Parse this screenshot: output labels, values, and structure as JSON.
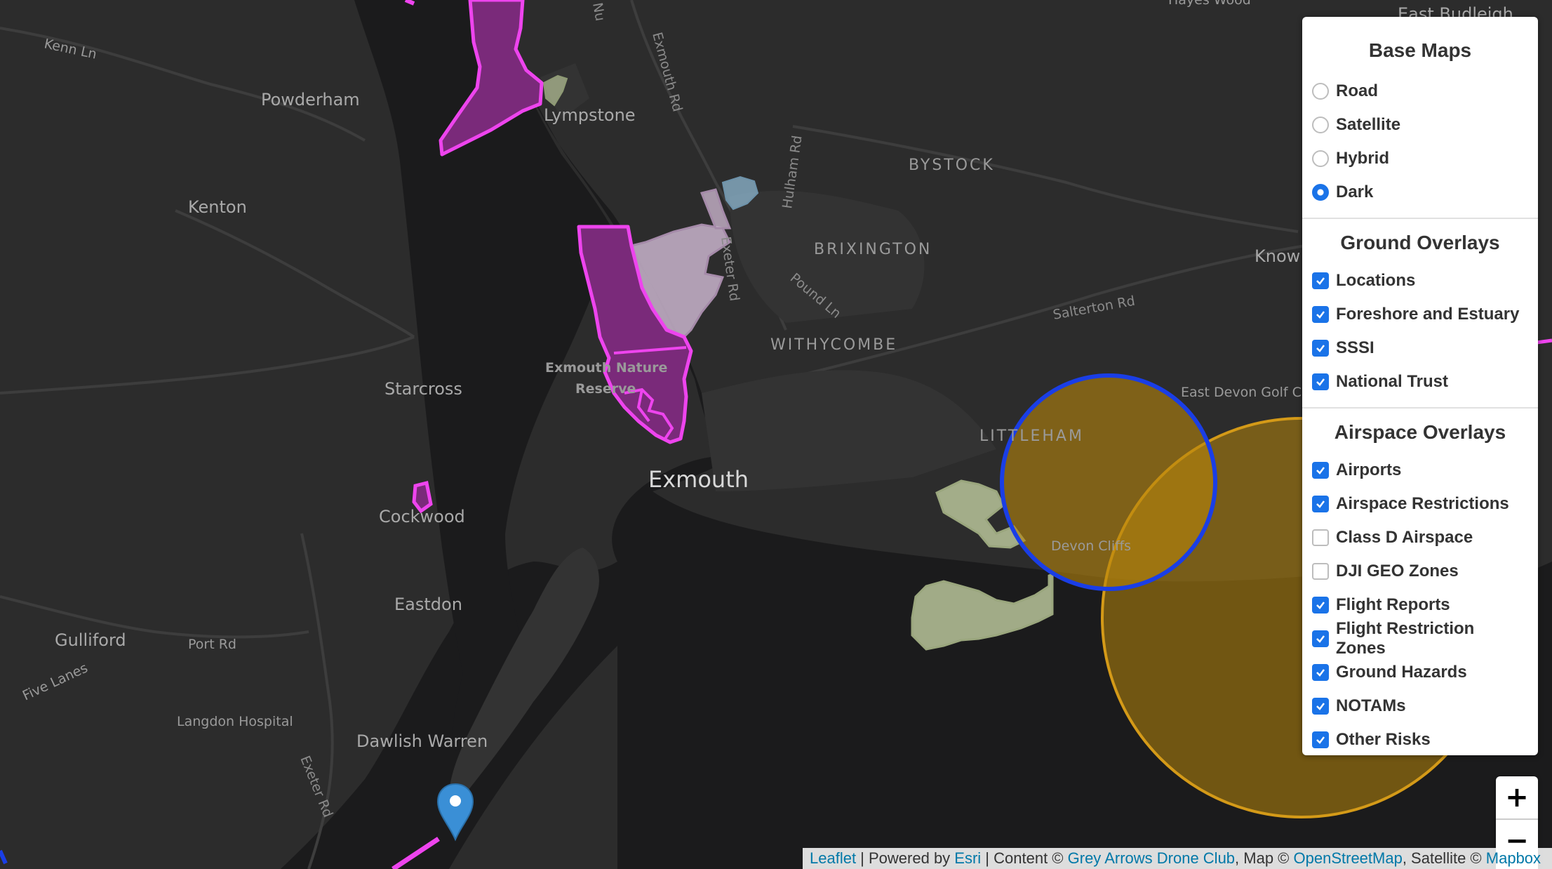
{
  "map": {
    "places": [
      {
        "id": "kenn-ln",
        "text": "Kenn Ln"
      },
      {
        "id": "powderham",
        "text": "Powderham"
      },
      {
        "id": "lympstone",
        "text": "Lympstone"
      },
      {
        "id": "exmouth-rd",
        "text": "Exmouth Rd"
      },
      {
        "id": "hulham-rd",
        "text": "Hulham Rd"
      },
      {
        "id": "bystock",
        "text": "BYSTOCK"
      },
      {
        "id": "kenton",
        "text": "Kenton"
      },
      {
        "id": "brixington",
        "text": "BRIXINGTON"
      },
      {
        "id": "exeter-rd-north",
        "text": "Exeter Rd"
      },
      {
        "id": "pound-ln",
        "text": "Pound Ln"
      },
      {
        "id": "salterton-rd",
        "text": "Salterton Rd"
      },
      {
        "id": "withycombe",
        "text": "WITHYCOMBE"
      },
      {
        "id": "exmouth-nature-reserve-1",
        "text": "Exmouth Nature"
      },
      {
        "id": "exmouth-nature-reserve-2",
        "text": "Reserve"
      },
      {
        "id": "starcross",
        "text": "Starcross"
      },
      {
        "id": "east-devon-golf",
        "text": "East Devon Golf C"
      },
      {
        "id": "littleham",
        "text": "LITTLEHAM"
      },
      {
        "id": "exmouth",
        "text": "Exmouth"
      },
      {
        "id": "cockwood",
        "text": "Cockwood"
      },
      {
        "id": "devon-cliffs",
        "text": "Devon Cliffs"
      },
      {
        "id": "eastdon",
        "text": "Eastdon"
      },
      {
        "id": "gulliford",
        "text": "Gulliford"
      },
      {
        "id": "port-rd",
        "text": "Port Rd"
      },
      {
        "id": "five-lanes",
        "text": "Five Lanes"
      },
      {
        "id": "langdon-hospital",
        "text": "Langdon Hospital"
      },
      {
        "id": "dawlish-warren",
        "text": "Dawlish Warren"
      },
      {
        "id": "exeter-rd-south",
        "text": "Exeter Rd"
      },
      {
        "id": "hayes-wood",
        "text": "Hayes Wood"
      },
      {
        "id": "east-budleigh",
        "text": "East Budleigh"
      },
      {
        "id": "knowle",
        "text": "Know"
      },
      {
        "id": "nu",
        "text": "Nu"
      }
    ],
    "colors": {
      "land": "#2c2c2c",
      "water": "#1b1b1c",
      "sssi_fill": "#7a2a7a",
      "sssi_stroke": "#ee44ee",
      "airport_stroke": "#1a3ee6",
      "restriction_fill": "#b8860b",
      "trust_fill": "#b9c49a",
      "marker": "#3a8fd6"
    }
  },
  "layers": {
    "base_title": "Base Maps",
    "base": [
      {
        "label": "Road",
        "selected": false
      },
      {
        "label": "Satellite",
        "selected": false
      },
      {
        "label": "Hybrid",
        "selected": false
      },
      {
        "label": "Dark",
        "selected": true
      }
    ],
    "ground_title": "Ground Overlays",
    "ground": [
      {
        "label": "Locations",
        "checked": true
      },
      {
        "label": "Foreshore and Estuary",
        "checked": true
      },
      {
        "label": "SSSI",
        "checked": true
      },
      {
        "label": "National Trust",
        "checked": true
      }
    ],
    "air_title": "Airspace Overlays",
    "air": [
      {
        "label": "Airports",
        "checked": true
      },
      {
        "label": "Airspace Restrictions",
        "checked": true
      },
      {
        "label": "Class D Airspace",
        "checked": false
      },
      {
        "label": "DJI GEO Zones",
        "checked": false
      },
      {
        "label": "Flight Reports",
        "checked": true
      },
      {
        "label": "Flight Restriction Zones",
        "checked": true
      },
      {
        "label": "Ground Hazards",
        "checked": true
      },
      {
        "label": "NOTAMs",
        "checked": true
      },
      {
        "label": "Other Risks",
        "checked": true
      }
    ]
  },
  "zoom": {
    "in_label": "+",
    "out_label": "−"
  },
  "attribution": {
    "leaflet": "Leaflet",
    "sep1": " | Powered by ",
    "esri": "Esri",
    "sep2": " | Content © ",
    "club": "Grey Arrows Drone Club",
    "sep3": ", Map © ",
    "osm": "OpenStreetMap",
    "sep4": ", Satellite © ",
    "mapbox": "Mapbox"
  }
}
